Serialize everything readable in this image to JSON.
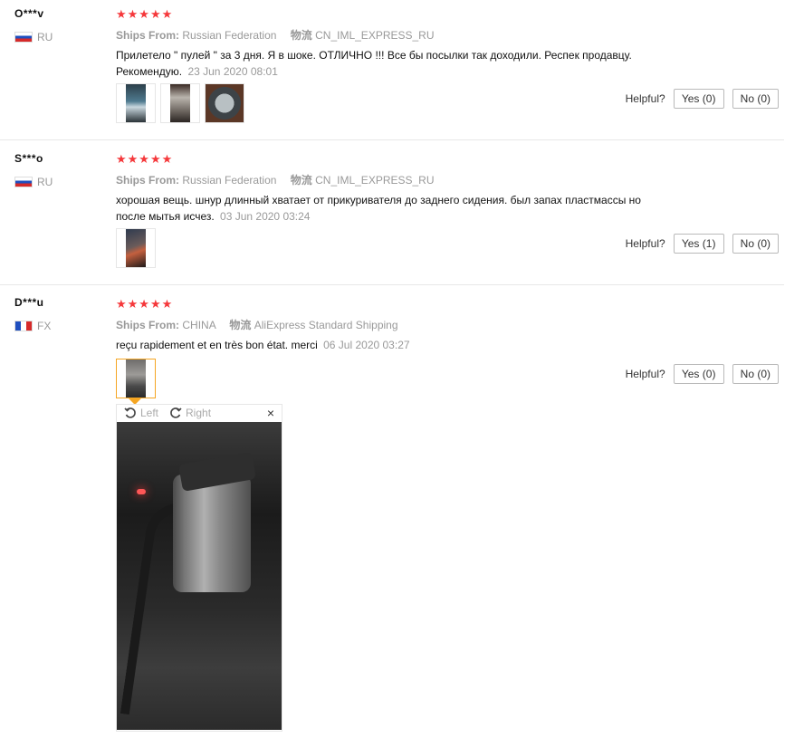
{
  "reviews": [
    {
      "user": "O***v",
      "country": "RU",
      "stars": "★★★★★",
      "ships_from_label": "Ships From:",
      "ships_from": "Russian Federation",
      "carrier_label": "物流",
      "carrier": "CN_IML_EXPRESS_RU",
      "text": "Прилетело \" пулей \" за 3 дня. Я в шоке. ОТЛИЧНО !!! Все бы посылки так доходили. Респек продавцу. Рекомендую.",
      "date": "23 Jun 2020 08:01",
      "helpful_label": "Helpful?",
      "yes_label": "Yes (0)",
      "no_label": "No (0)"
    },
    {
      "user": "S***o",
      "country": "RU",
      "stars": "★★★★★",
      "ships_from_label": "Ships From:",
      "ships_from": "Russian Federation",
      "carrier_label": "物流",
      "carrier": "CN_IML_EXPRESS_RU",
      "text": "хорошая вещь. шнур длинный хватает от прикуривателя до заднего сидения. был запах пластмассы но после мытья исчез.",
      "date": "03 Jun 2020 03:24",
      "helpful_label": "Helpful?",
      "yes_label": "Yes (1)",
      "no_label": "No (0)"
    },
    {
      "user": "D***u",
      "country": "FX",
      "stars": "★★★★★",
      "ships_from_label": "Ships From:",
      "ships_from": "CHINA",
      "carrier_label": "物流",
      "carrier": "AliExpress Standard Shipping",
      "text": "reçu rapidement et en très bon état. merci",
      "date": "06 Jul 2020 03:27",
      "helpful_label": "Helpful?",
      "yes_label": "Yes (0)",
      "no_label": "No (0)"
    }
  ],
  "viewer": {
    "rotate_left": "Left",
    "rotate_right": "Right",
    "close": "×"
  },
  "colors": {
    "star": "#f5383b",
    "accent": "#f5a623",
    "muted": "#999999"
  }
}
